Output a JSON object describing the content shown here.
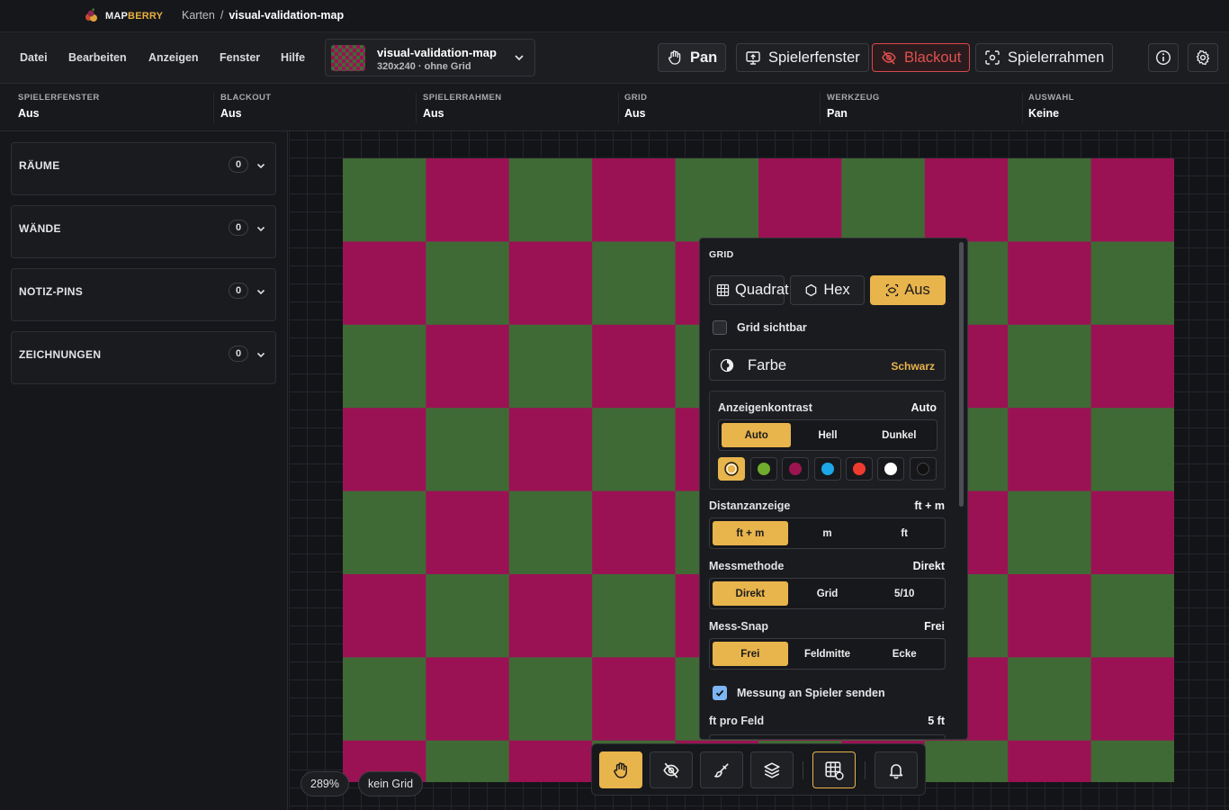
{
  "app": {
    "brand_a": "MAP",
    "brand_b": "BERRY"
  },
  "breadcrumb": {
    "root": "Karten",
    "sep": "/",
    "current": "visual-validation-map"
  },
  "menu": [
    "Datei",
    "Bearbeiten",
    "Anzeigen",
    "Fenster",
    "Hilfe"
  ],
  "map_selector": {
    "name": "visual-validation-map",
    "meta": "320x240 · ohne Grid"
  },
  "toolbar": {
    "pan": "Pan",
    "player_window": "Spielerfenster",
    "blackout": "Blackout",
    "player_frame": "Spielerrahmen"
  },
  "status": [
    {
      "key": "SPIELERFENSTER",
      "value": "Aus"
    },
    {
      "key": "BLACKOUT",
      "value": "Aus"
    },
    {
      "key": "SPIELERRAHMEN",
      "value": "Aus"
    },
    {
      "key": "GRID",
      "value": "Aus"
    },
    {
      "key": "WERKZEUG",
      "value": "Pan"
    },
    {
      "key": "AUSWAHL",
      "value": "Keine"
    }
  ],
  "sidebar": [
    {
      "label": "RÄUME",
      "count": "0"
    },
    {
      "label": "WÄNDE",
      "count": "0"
    },
    {
      "label": "NOTIZ-PINS",
      "count": "0"
    },
    {
      "label": "ZEICHNUNGEN",
      "count": "0"
    }
  ],
  "map": {
    "colors": [
      "#9b1254",
      "#3f6a35"
    ],
    "zoom": "289%",
    "grid_label": "kein Grid"
  },
  "grid_panel": {
    "title": "GRID",
    "modes": [
      {
        "label": "Quadrat",
        "active": false
      },
      {
        "label": "Hex",
        "active": false
      },
      {
        "label": "Aus",
        "active": true
      }
    ],
    "visible_label": "Grid sichtbar",
    "visible": false,
    "color_label": "Farbe",
    "color_value": "Schwarz",
    "contrast": {
      "label": "Anzeigenkontrast",
      "value": "Auto",
      "options": [
        "Auto",
        "Hell",
        "Dunkel"
      ],
      "active": 0
    },
    "swatches": [
      "auto",
      "#6fae2d",
      "#9c1550",
      "#1da7e8",
      "#ee3b30",
      "#ffffff",
      "#111111"
    ],
    "distance": {
      "label": "Distanzanzeige",
      "value": "ft + m",
      "options": [
        "ft + m",
        "m",
        "ft"
      ],
      "active": 0
    },
    "method": {
      "label": "Messmethode",
      "value": "Direkt",
      "options": [
        "Direkt",
        "Grid",
        "5/10"
      ],
      "active": 0
    },
    "snap": {
      "label": "Mess-Snap",
      "value": "Frei",
      "options": [
        "Frei",
        "Feldmitte",
        "Ecke"
      ],
      "active": 0
    },
    "send_label": "Messung an Spieler senden",
    "send": true,
    "per_cell": {
      "label": "ft pro Feld",
      "value": "5 ft"
    }
  },
  "accent": "#e8b44c"
}
